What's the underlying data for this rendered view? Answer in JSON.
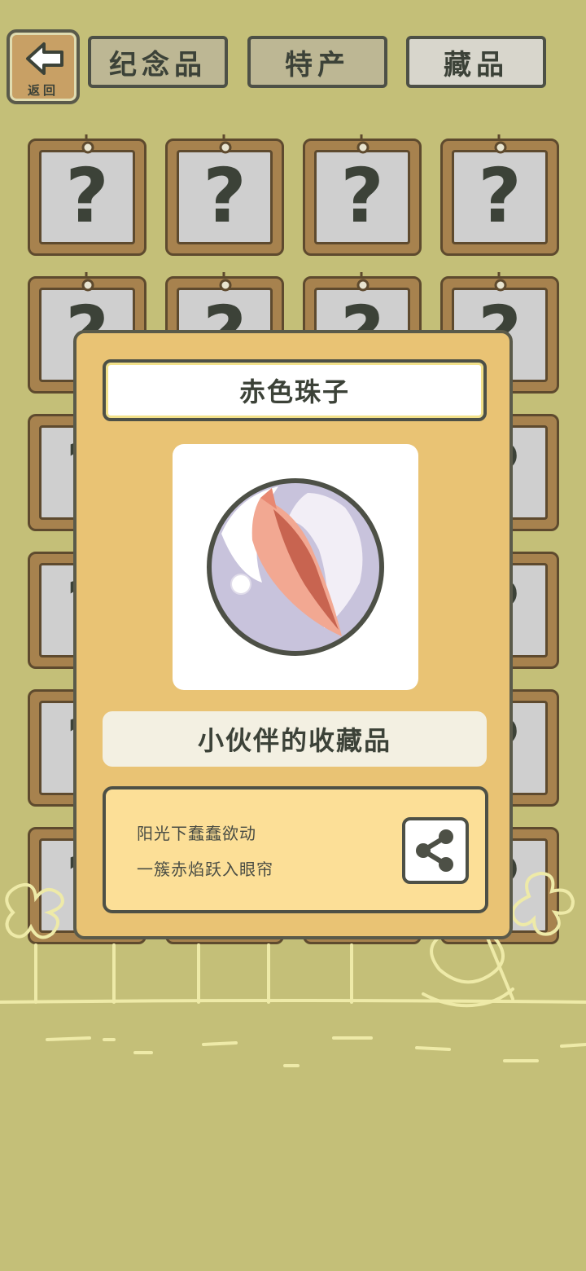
{
  "nav": {
    "back_label": "返回",
    "tabs": [
      {
        "label": "纪念品",
        "active": false
      },
      {
        "label": "特产",
        "active": false
      },
      {
        "label": "藏品",
        "active": true
      }
    ]
  },
  "grid": {
    "placeholder_symbol": "?"
  },
  "modal": {
    "title": "赤色珠子",
    "category": "小伙伴的收藏品",
    "description": [
      "阳光下蠢蠢欲动",
      "一簇赤焰跃入眼帘"
    ],
    "share_icon": "share-icon"
  },
  "colors": {
    "background": "#c4bf78",
    "modal": "#e9c374",
    "frame": "#a7824e"
  }
}
